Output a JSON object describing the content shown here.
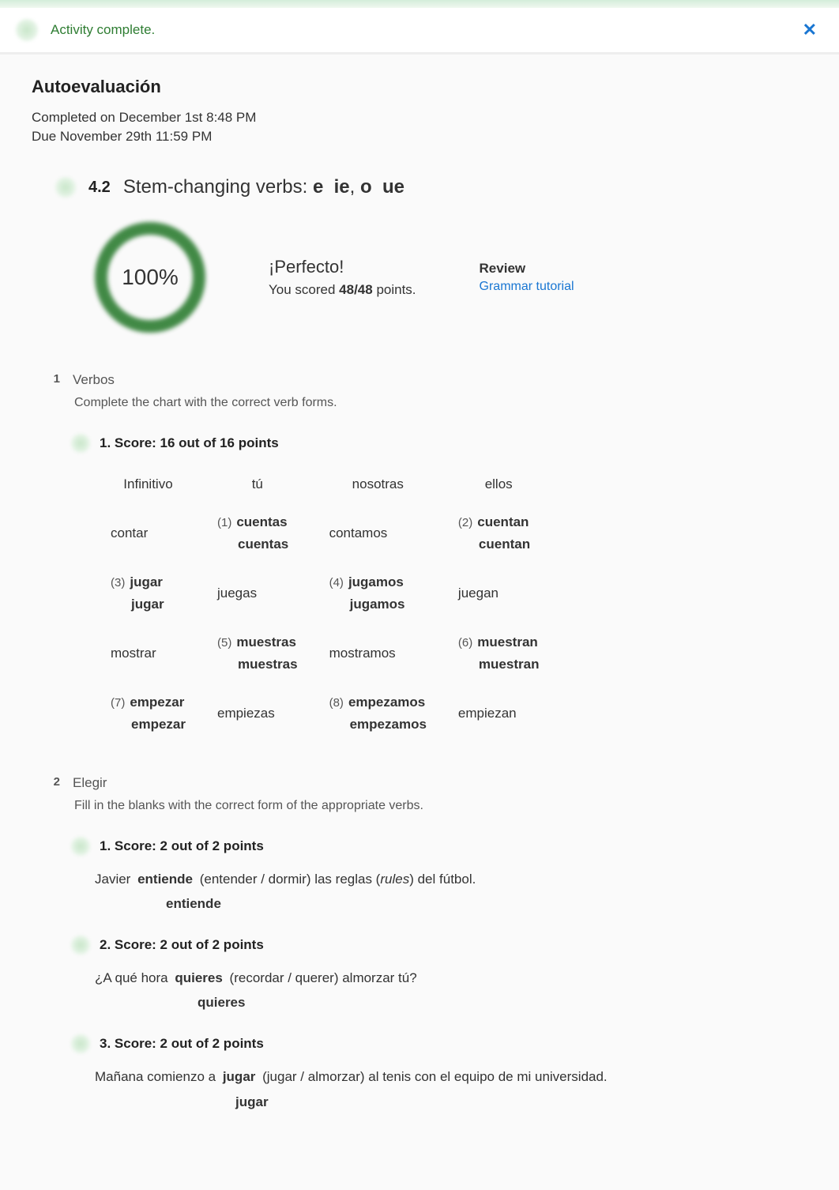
{
  "banner": {
    "text": "Activity complete."
  },
  "page": {
    "title": "Autoevaluación",
    "completed": "Completed on December 1st 8:48 PM",
    "due": "Due November 29th 11:59 PM"
  },
  "lesson": {
    "number": "4.2",
    "title_prefix": "Stem-changing verbs: ",
    "title_bold1": "e",
    "title_mid1": "ie",
    "title_sep": ", ",
    "title_bold2": "o",
    "title_mid2": "ue"
  },
  "score": {
    "percent": "100%",
    "headline": "¡Perfecto!",
    "sub_prefix": "You scored ",
    "sub_points": "48/48",
    "sub_suffix": " points."
  },
  "review": {
    "header": "Review",
    "link": "Grammar tutorial"
  },
  "section1": {
    "num": "1",
    "title": "Verbos",
    "instr": "Complete the chart with the correct verb forms.",
    "q1": {
      "label": "1.  Score: 16 out of 16 points"
    },
    "table": {
      "headers": [
        "Infinitivo",
        "tú",
        "nosotras",
        "ellos"
      ],
      "rows": [
        {
          "c0": {
            "plain": "contar"
          },
          "c1": {
            "num": "(1)",
            "ans": "cuentas",
            "confirm": "cuentas"
          },
          "c2": {
            "plain": "contamos"
          },
          "c3": {
            "num": "(2)",
            "ans": "cuentan",
            "confirm": "cuentan"
          }
        },
        {
          "c0": {
            "num": "(3)",
            "ans": "jugar",
            "confirm": "jugar"
          },
          "c1": {
            "plain": "juegas"
          },
          "c2": {
            "num": "(4)",
            "ans": "jugamos",
            "confirm": "jugamos"
          },
          "c3": {
            "plain": "juegan"
          }
        },
        {
          "c0": {
            "plain": "mostrar"
          },
          "c1": {
            "num": "(5)",
            "ans": "muestras",
            "confirm": "muestras"
          },
          "c2": {
            "plain": "mostramos"
          },
          "c3": {
            "num": "(6)",
            "ans": "muestran",
            "confirm": "muestran"
          }
        },
        {
          "c0": {
            "num": "(7)",
            "ans": "empezar",
            "confirm": "empezar"
          },
          "c1": {
            "plain": "empiezas"
          },
          "c2": {
            "num": "(8)",
            "ans": "empezamos",
            "confirm": "empezamos"
          },
          "c3": {
            "plain": "empiezan"
          }
        }
      ]
    }
  },
  "section2": {
    "num": "2",
    "title": "Elegir",
    "instr": "Fill in the blanks with the correct form of the appropriate verbs.",
    "questions": [
      {
        "label": "1.  Score: 2 out of 2 points",
        "pre": "Javier ",
        "blank": "entiende",
        "post": " (entender / dormir) las reglas (",
        "italic": "rules",
        "post2": ") del fútbol.",
        "confirm": "entiende",
        "confirmClass": "c1"
      },
      {
        "label": "2.  Score: 2 out of 2 points",
        "pre": "¿A qué hora ",
        "blank": "quieres",
        "post": " (recordar / querer) almorzar tú?",
        "italic": "",
        "post2": "",
        "confirm": "quieres",
        "confirmClass": "c2"
      },
      {
        "label": "3.  Score: 2 out of 2 points",
        "pre": "Mañana comienzo a ",
        "blank": "jugar",
        "post": " (jugar / almorzar) al tenis con el equipo de mi universidad.",
        "italic": "",
        "post2": "",
        "confirm": "jugar",
        "confirmClass": "c3"
      }
    ]
  }
}
